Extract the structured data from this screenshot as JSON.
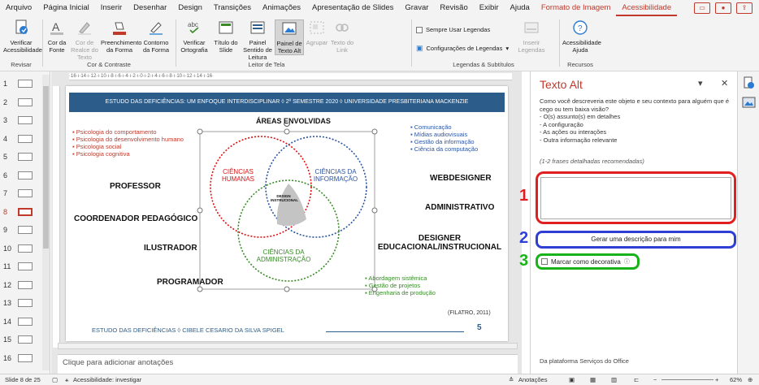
{
  "menu": {
    "tabs": [
      "Arquivo",
      "Página Inicial",
      "Inserir",
      "Desenhar",
      "Design",
      "Transições",
      "Animações",
      "Apresentação de Slides",
      "Gravar",
      "Revisão",
      "Exibir",
      "Ajuda"
    ],
    "format_tab": "Formato de Imagem",
    "active_tab": "Acessibilidade"
  },
  "ribbon": {
    "btn_verificar": "Verificar Acessibilidade",
    "grp_revisar": "Revisar",
    "btn_cor_fonte": "Cor da Fonte",
    "btn_cor_realce": "Cor de Realce do Texto",
    "btn_preenchimento": "Preenchimento da Forma",
    "btn_contorno": "Contorno da Forma",
    "grp_cor": "Cor & Contraste",
    "btn_ortografia": "Verificar Ortografia",
    "btn_titulo": "Título do Slide",
    "btn_sentido": "Painel Sentido de Leitura",
    "btn_painel_alt": "Painel de Texto Alt",
    "btn_agrupar": "Agrupar",
    "btn_texto_link": "Texto do Link",
    "grp_leitor": "Leitor de Tela",
    "chk_legendas": "Sempre Usar Legendas",
    "btn_config_legendas": "Configurações de Legendas",
    "btn_inserir_legendas": "Inserir Legendas",
    "grp_legendas": "Legendas & Subtítulos",
    "btn_ajuda": "Acessibilidade Ajuda",
    "grp_recursos": "Recursos"
  },
  "thumbnails": [
    "1",
    "2",
    "3",
    "4",
    "5",
    "6",
    "7",
    "8",
    "9",
    "10",
    "11",
    "12",
    "13",
    "14",
    "15",
    "16"
  ],
  "ruler": "·16·ı·14·ı·12·ı·10·ı·8·ı·6·ı·4·ı·2·ı·0·ı·2·ı·4·ı·6·ı·8·ı·10·ı·12·ı·14·ı·16·",
  "slide": {
    "header": "ESTUDO DAS DEFICIÊNCIAS: UM ENFOQUE INTERDISCIPLINAR ◊ 2º SEMESTRE 2020 ◊ UNIVERSIDADE PRESBITERIANA MACKENZIE",
    "areas_title": "ÁREAS ENVOLVIDAS",
    "red_list": [
      "Psicologia do comportamento",
      "Psicologia do desenvolvimento humano",
      "Psicologia social",
      "Psicologia cognitiva"
    ],
    "blue_list": [
      "Comunicação",
      "Mídias audiovisuais",
      "Gestão da informação",
      "Ciência da computação"
    ],
    "green_list": [
      "Abordagem sistêmica",
      "Gestão de projetos",
      "Engenharia de produção"
    ],
    "circle_humanas": "CIÊNCIAS HUMANAS",
    "circle_informacao": "CIÊNCIAS DA INFORMAÇÃO",
    "circle_administracao": "CIÊNCIAS DA ADMINISTRAÇÃO",
    "center": "DESIGN INSTRUCIONAL",
    "professor": "PROFESSOR",
    "coordenador": "COORDENADOR PEDAGÓGICO",
    "ilustrador": "ILUSTRADOR",
    "programador": "PROGRAMADOR",
    "webdesigner": "WEBDESIGNER",
    "administrativo": "ADMINISTRATIVO",
    "designer": "DESIGNER EDUCACIONAL/INSTRUCIONAL",
    "citation": "(FILATRO, 2011)",
    "footer": "ESTUDO DAS DEFICIÊNCIAS ◊ CIBELE CESARIO DA SILVA SPIGEL",
    "page_number": "5"
  },
  "notes_placeholder": "Clique para adicionar anotações",
  "pane": {
    "title": "Texto Alt",
    "description": "Como você descreveria este objeto e seu contexto para alguém que é cego ou tem baixa visão?\n- O(s) assunto(s) em detalhes\n- A configuração\n- As ações ou interações\n- Outra informação relevante",
    "hint": "(1-2 frases detalhadas recomendadas)",
    "generate_button": "Gerar uma descrição para mim",
    "decorative_label": "Marcar como decorativa",
    "footer": "Da plataforma Serviços do Office",
    "label_1": "1",
    "label_2": "2",
    "label_3": "3"
  },
  "status": {
    "slide_info": "Slide 8 de 25",
    "accessibility": "Acessibilidade: investigar",
    "notes": "Anotações",
    "zoom": "62%"
  },
  "colors": {
    "accent": "#c0392b",
    "header_blue": "#2b5c8a",
    "box1_red": "#e02020",
    "box2_blue": "#2f3fd4",
    "box3_green": "#19b319"
  }
}
